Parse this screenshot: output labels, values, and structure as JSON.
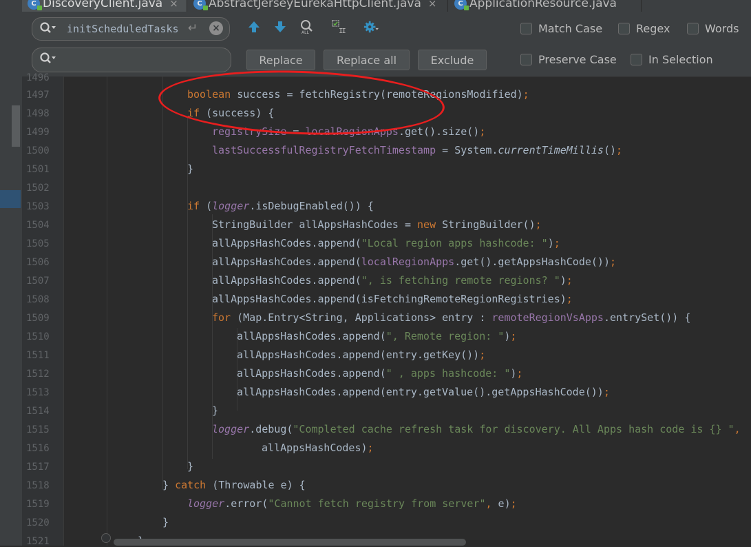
{
  "tabs": [
    {
      "name": "DiscoveryClient.java",
      "icon": "class-icon",
      "closable": true,
      "active": true
    },
    {
      "name": "AbstractJerseyEurekaHttpClient.java",
      "icon": "class-icon",
      "closable": true,
      "active": false
    },
    {
      "name": "ApplicationResource.java",
      "icon": "class-icon",
      "closable": false,
      "active": false
    }
  ],
  "find": {
    "search_value": "initScheduledTasks",
    "replace_value": "",
    "enter_glyph": "↵",
    "clear_glyph": "×",
    "icons": [
      "arrow-up-icon",
      "arrow-down-icon",
      "find-all-occurrences-icon",
      "select-all-occurrences-icon",
      "settings-gear-icon"
    ],
    "buttons": {
      "replace": "Replace",
      "replace_all": "Replace all",
      "exclude": "Exclude"
    },
    "options": {
      "match_case": "Match Case",
      "regex": "Regex",
      "words": "Words",
      "preserve_case": "Preserve Case",
      "in_selection": "In Selection"
    }
  },
  "editor": {
    "line_numbers": [
      "1496",
      "1497",
      "1498",
      "1499",
      "1500",
      "1501",
      "1502",
      "1503",
      "1504",
      "1505",
      "1506",
      "1507",
      "1508",
      "1509",
      "1510",
      "1511",
      "1512",
      "1513",
      "1514",
      "1515",
      "1516",
      "1517",
      "1518",
      "1519",
      "1520",
      "1521"
    ],
    "code": {
      "l1497": {
        "kw": "boolean",
        "a": " success = fetchRegistry(remoteRegionsModified)",
        "semi": ";"
      },
      "l1498": {
        "kw": "if",
        "a": " (success) {"
      },
      "l1499": {
        "f1": "registrySize",
        "a": " = ",
        "f2": "localRegionApps",
        "b": ".get().size()",
        "semi": ";"
      },
      "l1500": {
        "f1": "lastSuccessfulRegistryFetchTimestamp",
        "a": " = System.",
        "it": "currentTimeMillis",
        "b": "()",
        "semi": ";"
      },
      "l1501": {
        "a": "}"
      },
      "l1503": {
        "kw": "if",
        "a": " (",
        "fit": "logger",
        "b": ".isDebugEnabled()) {"
      },
      "l1504": {
        "a": "StringBuilder allAppsHashCodes = ",
        "kw": "new",
        "b": " StringBuilder()",
        "semi": ";"
      },
      "l1505": {
        "a": "allAppsHashCodes.append(",
        "str": "\"Local region apps hashcode: \"",
        "b": ")",
        "semi": ";"
      },
      "l1506": {
        "a": "allAppsHashCodes.append(",
        "f1": "localRegionApps",
        "b": ".get().getAppsHashCode())",
        "semi": ";"
      },
      "l1507": {
        "a": "allAppsHashCodes.append(",
        "str": "\", is fetching remote regions? \"",
        "b": ")",
        "semi": ";"
      },
      "l1508": {
        "a": "allAppsHashCodes.append(isFetchingRemoteRegionRegistries)",
        "semi": ";"
      },
      "l1509": {
        "kw": "for",
        "a": " (Map.Entry<String, Applications> entry : ",
        "f1": "remoteRegionVsApps",
        "b": ".entrySet()) {"
      },
      "l1510": {
        "a": "allAppsHashCodes.append(",
        "str": "\", Remote region: \"",
        "b": ")",
        "semi": ";"
      },
      "l1511": {
        "a": "allAppsHashCodes.append(entry.getKey())",
        "semi": ";"
      },
      "l1512": {
        "a": "allAppsHashCodes.append(",
        "str": "\" , apps hashcode: \"",
        "b": ")",
        "semi": ";"
      },
      "l1513": {
        "a": "allAppsHashCodes.append(entry.getValue().getAppsHashCode())",
        "semi": ";"
      },
      "l1514": {
        "a": "}"
      },
      "l1515": {
        "fit": "logger",
        "a": ".debug(",
        "str": "\"Completed cache refresh task for discovery. All Apps hash code is {} \"",
        "semi": ","
      },
      "l1516": {
        "a": "allAppsHashCodes)",
        "semi": ";"
      },
      "l1517": {
        "a": "}"
      },
      "l1518": {
        "a": "} ",
        "kw": "catch",
        "b": " (Throwable e) {"
      },
      "l1519": {
        "fit": "logger",
        "a": ".error(",
        "str": "\"Cannot fetch registry from server\"",
        "semi": ",",
        "b": " e)",
        "semi2": ";"
      },
      "l1520": {
        "a": "}"
      },
      "l1521": {
        "a": "}"
      }
    }
  },
  "colors": {
    "editor_bg": "#2b2b2b",
    "keyword": "#cc7832",
    "field": "#9876aa",
    "string": "#6a8759",
    "text": "#a9b7c6",
    "highlight_ellipse": "#e81e1e"
  }
}
